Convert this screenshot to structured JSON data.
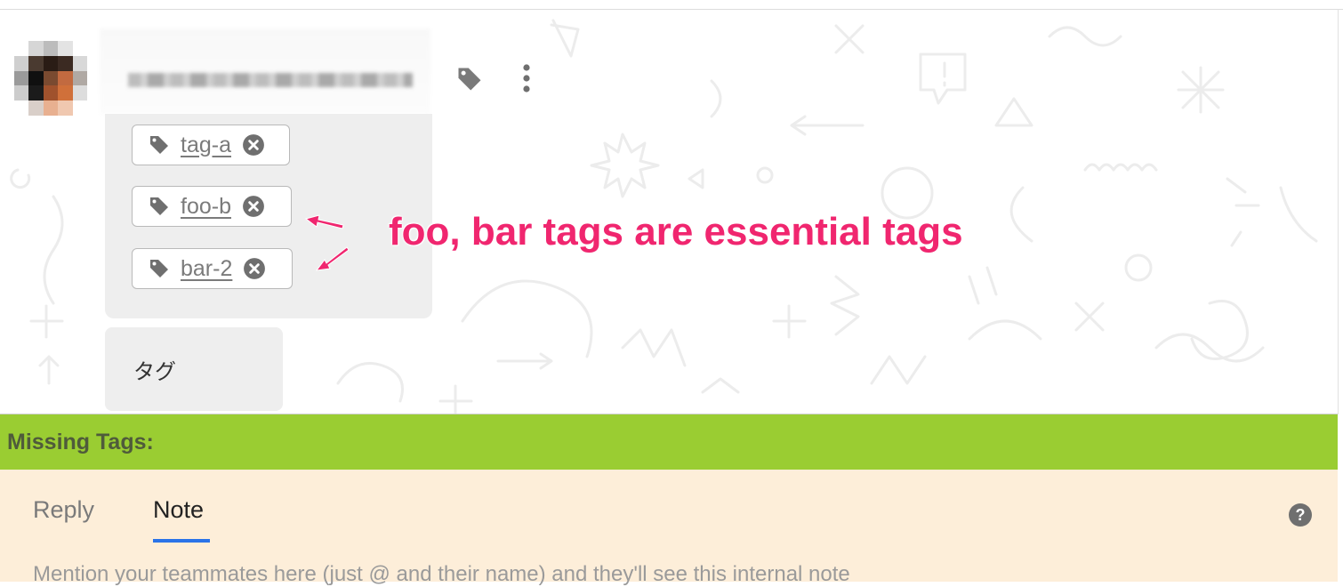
{
  "conversation": {
    "avatar_alt": "",
    "tags": [
      {
        "label": "tag-a"
      },
      {
        "label": "foo-b"
      },
      {
        "label": "bar-2"
      }
    ],
    "tag_input_value": "タグ",
    "annotation": "foo, bar tags are essential tags"
  },
  "missing_tags": {
    "label": "Missing Tags:",
    "color": "#9acd32"
  },
  "composer": {
    "tabs": [
      {
        "label": "Reply",
        "active": false
      },
      {
        "label": "Note",
        "active": true
      }
    ],
    "placeholder": "Mention your teammates here (just @ and their name) and they'll see this internal note",
    "background": "#fdeed9"
  },
  "colors": {
    "accent": "#2a73e8",
    "annotation": "#f0266f"
  }
}
